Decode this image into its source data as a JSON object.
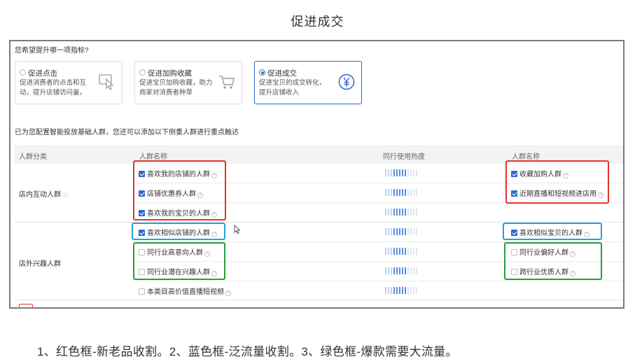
{
  "page_title": "促进成交",
  "question": "您希望提升哪一项指标?",
  "goals": [
    {
      "title": "促进点击",
      "desc": "促进消费者的点击和互动，提升店铺访问量。",
      "icon": "pointer-click-icon",
      "selected": false
    },
    {
      "title": "促进加购收藏",
      "desc": "促进宝贝加购收藏，助力商家对消费者种草",
      "icon": "shopping-cart-icon",
      "selected": false
    },
    {
      "title": "促进成交",
      "desc": "促进宝贝的成交转化，提升店铺收入",
      "icon": "yen-circle-icon",
      "selected": true
    }
  ],
  "config_text": "已为您配置智能投放基础人群，您还可以添加以下侧重人群进行重点触达",
  "table": {
    "headers": [
      "人群分类",
      "人群名称",
      "同行使用热度",
      "人群名称"
    ],
    "groups": [
      {
        "category": "店内互动人群"
      },
      {
        "category": "店外兴趣人群"
      }
    ],
    "left_items": [
      {
        "label": "喜欢我的店铺的人群",
        "checked": true
      },
      {
        "label": "店铺优惠券人群",
        "checked": true
      },
      {
        "label": "喜欢我的宝贝的人群",
        "checked": true
      },
      {
        "label": "喜欢相似店铺的人群",
        "checked": true
      },
      {
        "label": "同行业高意向人群",
        "checked": false
      },
      {
        "label": "同行业潜在兴趣人群",
        "checked": false
      },
      {
        "label": "本类目高价值直播短视频",
        "checked": false
      }
    ],
    "right_items": [
      {
        "label": "收藏加购人群",
        "checked": true
      },
      {
        "label": "近期直播和短视频进店用",
        "checked": true
      },
      {
        "label": "喜欢相似宝贝的人群",
        "checked": true
      },
      {
        "label": "同行业偏好人群",
        "checked": false
      },
      {
        "label": "跨行业优质人群",
        "checked": false
      }
    ],
    "heat_levels": [
      0.7,
      0.7,
      0.7,
      0.7,
      0.7,
      0.7,
      0.7
    ]
  },
  "bottom_caption": "1、红色框-新老品收割。2、蓝色框-泛流量收割。3、绿色框-爆款需要大流量。",
  "colors": {
    "accent": "#2f69c9",
    "red_box": "#e0352b",
    "blue_box": "#2b9de3",
    "green_box": "#25a03a"
  }
}
